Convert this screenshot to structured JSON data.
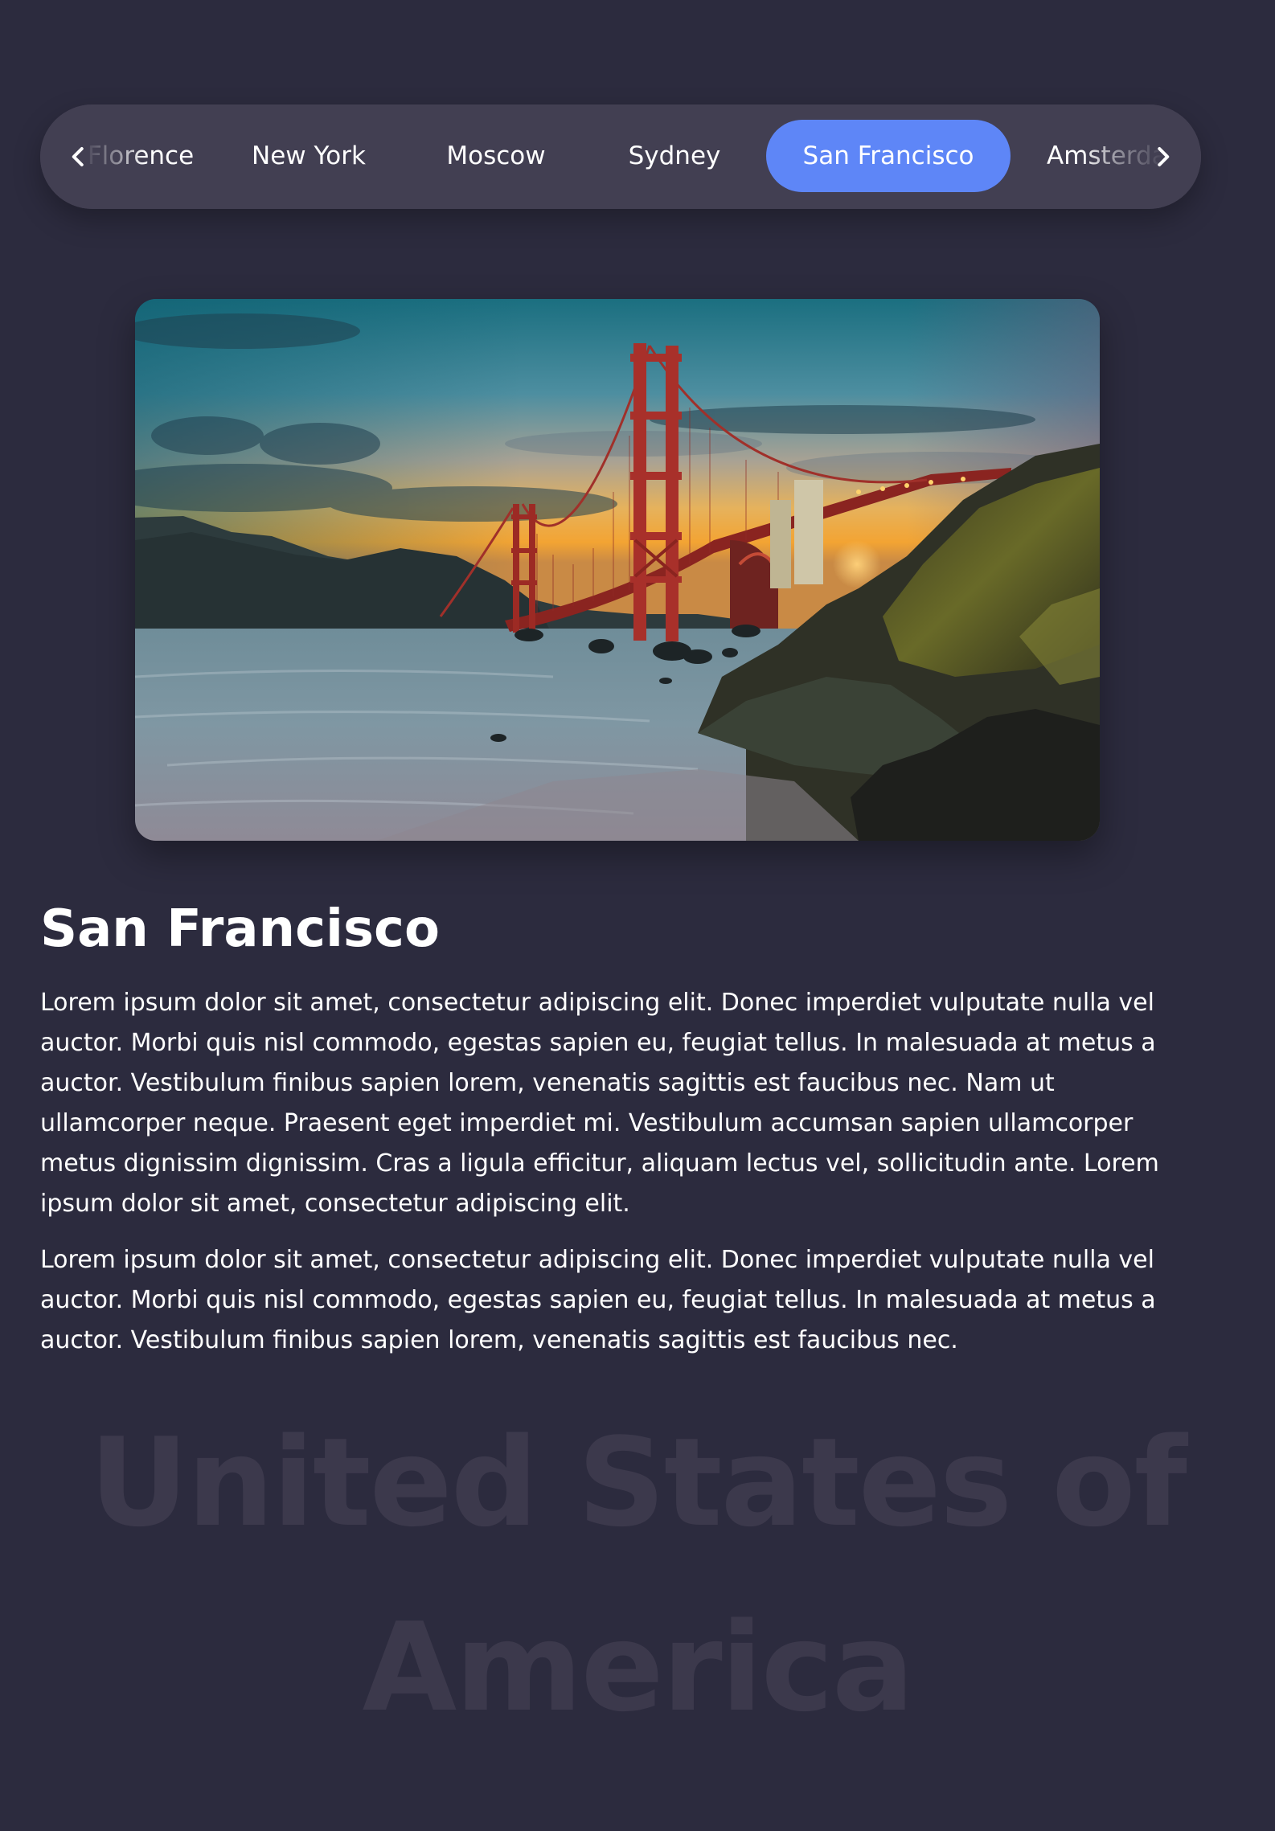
{
  "nav": {
    "tabs": [
      {
        "label": "Florence",
        "active": false
      },
      {
        "label": "New York",
        "active": false
      },
      {
        "label": "Moscow",
        "active": false
      },
      {
        "label": "Sydney",
        "active": false
      },
      {
        "label": "San Francisco",
        "active": true
      },
      {
        "label": "Amsterdam",
        "active": false
      }
    ],
    "prev_icon": "chevron-left-icon",
    "next_icon": "chevron-right-icon"
  },
  "hero": {
    "icon": "golden-gate-bridge-photo"
  },
  "content": {
    "title": "San Francisco",
    "paragraphs": [
      "Lorem ipsum dolor sit amet, consectetur adipiscing elit. Donec imperdiet vulputate nulla vel auctor. Morbi quis nisl commodo, egestas sapien eu, feugiat tellus. In malesuada at metus a auctor. Vestibulum finibus sapien lorem, venenatis sagittis est faucibus nec. Nam ut ullamcorper neque. Praesent eget imperdiet mi. Vestibulum accumsan sapien ullamcorper metus dignissim dignissim. Cras a ligula efficitur, aliquam lectus vel, sollicitudin ante. Lorem ipsum dolor sit amet, consectetur adipiscing elit.",
      "Lorem ipsum dolor sit amet, consectetur adipiscing elit. Donec imperdiet vulputate nulla vel auctor. Morbi quis nisl commodo, egestas sapien eu, feugiat tellus. In malesuada at metus a auctor. Vestibulum finibus sapien lorem, venenatis sagittis est faucibus nec."
    ]
  },
  "watermark": {
    "line1": "United States of",
    "line2": "America"
  },
  "colors": {
    "background": "#2c2b3e",
    "tabbar": "#423f52",
    "accent": "#5e86f7",
    "watermark": "#3c394c"
  }
}
